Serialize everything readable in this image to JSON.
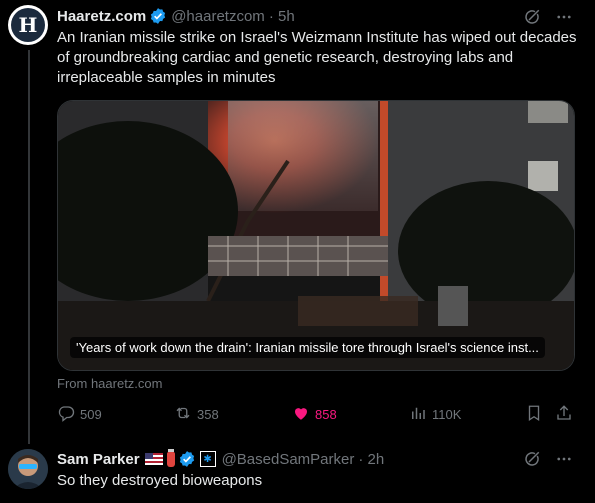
{
  "tweet": {
    "author_name": "Haaretz.com",
    "handle": "@haaretzcom",
    "time": "· 5h",
    "avatar_letter": "H",
    "text": "An Iranian missile strike on Israel's Weizmann Institute has wiped out decades of groundbreaking cardiac and genetic research, destroying labs and irreplaceable samples in minutes",
    "card_caption": "'Years of work down the drain': Iranian missile tore through Israel's science inst...",
    "card_source": "From haaretz.com",
    "stats": {
      "replies": "509",
      "reposts": "358",
      "likes": "858",
      "views": "110K"
    }
  },
  "reply": {
    "author_name": "Sam Parker",
    "handle": "@BasedSamParker",
    "time": "· 2h",
    "text": "So they destroyed bioweapons"
  },
  "colors": {
    "background": "#000000",
    "text": "#e7e9ea",
    "muted": "#71767b",
    "verified": "#1d9bf0",
    "like": "#f91880",
    "divider": "#333639"
  },
  "icons": [
    "grok-icon",
    "more-icon",
    "verified-icon",
    "reply-icon",
    "repost-icon",
    "heart-icon",
    "views-icon",
    "bookmark-icon",
    "share-icon"
  ]
}
